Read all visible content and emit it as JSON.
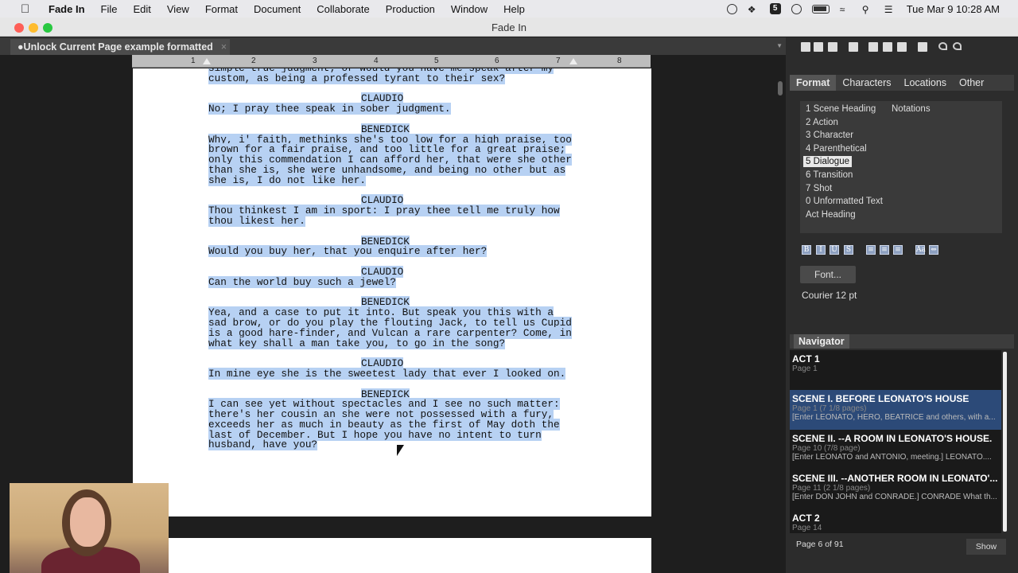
{
  "menubar": {
    "app_name": "Fade In",
    "items": [
      "File",
      "Edit",
      "View",
      "Format",
      "Document",
      "Collaborate",
      "Production",
      "Window",
      "Help"
    ],
    "clock": "Tue Mar 9  10:28 AM",
    "tray_icons": [
      "record-icon",
      "dropbox-icon",
      "five-icon",
      "play-icon",
      "battery-icon",
      "wifi-icon",
      "search-icon",
      "control-center-icon"
    ]
  },
  "window": {
    "title": "Fade In"
  },
  "document_tab": {
    "label": "●Unlock Current Page example formatted",
    "close": "×"
  },
  "ruler": {
    "numbers": [
      "1",
      "2",
      "3",
      "4",
      "5",
      "6",
      "7",
      "8"
    ]
  },
  "script": {
    "blocks": [
      {
        "type": "dialogue",
        "lines": [
          "simple true judgment; or would you have me speak after my",
          "custom, as being a professed tyrant to their sex?"
        ]
      },
      {
        "type": "character",
        "lines": [
          "CLAUDIO"
        ]
      },
      {
        "type": "dialogue",
        "lines": [
          "No; I pray thee speak in sober judgment."
        ]
      },
      {
        "type": "character",
        "lines": [
          "BENEDICK"
        ]
      },
      {
        "type": "dialogue",
        "lines": [
          "Why, i' faith, methinks she's too low for a high praise, too",
          "brown for a fair praise, and too little for a great praise;",
          "only this commendation I can afford her, that were she other",
          "than she is, she were unhandsome, and being no other but as",
          "she is, I do not like her."
        ]
      },
      {
        "type": "character",
        "lines": [
          "CLAUDIO"
        ]
      },
      {
        "type": "dialogue",
        "lines": [
          "Thou thinkest I am in sport: I pray thee tell me truly how",
          "thou likest her."
        ]
      },
      {
        "type": "character",
        "lines": [
          "BENEDICK"
        ]
      },
      {
        "type": "dialogue",
        "lines": [
          "Would you buy her, that you enquire after her?"
        ]
      },
      {
        "type": "character",
        "lines": [
          "CLAUDIO"
        ]
      },
      {
        "type": "dialogue",
        "lines": [
          "Can the world buy such a jewel?"
        ]
      },
      {
        "type": "character",
        "lines": [
          "BENEDICK"
        ]
      },
      {
        "type": "dialogue",
        "lines": [
          "Yea, and a case to put it into. But speak you this with a",
          "sad brow, or do you play the flouting Jack, to tell us Cupid",
          "is a good hare-finder, and Vulcan a rare carpenter? Come, in",
          "what key shall a man take you, to go in the song?"
        ]
      },
      {
        "type": "character",
        "lines": [
          "CLAUDIO"
        ]
      },
      {
        "type": "dialogue",
        "lines": [
          "In mine eye she is the sweetest lady that ever I looked on."
        ]
      },
      {
        "type": "character",
        "lines": [
          "BENEDICK"
        ]
      },
      {
        "type": "dialogue",
        "lines": [
          "I can see yet without spectacles and I see no such matter:",
          "there's her cousin an she were not possessed with a fury,",
          "exceeds her as much in beauty as the first of May doth the",
          "last of December. But I hope you have no intent to turn",
          "husband, have you?"
        ]
      }
    ]
  },
  "sidebar": {
    "tabs": [
      "Format",
      "Characters",
      "Locations",
      "Other"
    ],
    "active_tab": "Format",
    "format_items": [
      "1 Scene Heading",
      "2 Action",
      "3 Character",
      "4 Parenthetical",
      "5 Dialogue",
      "6 Transition",
      "7 Shot",
      "0 Unformatted Text",
      "Act Heading"
    ],
    "selected_format": "5 Dialogue",
    "notations": "Notations",
    "style_buttons": [
      "B",
      "I",
      "U",
      "S",
      "≡",
      "≡",
      "≡",
      "Aa",
      "⇔"
    ],
    "font_button": "Font...",
    "font_info": "Courier 12 pt",
    "navigator_label": "Navigator",
    "navigator_items": [
      {
        "title": "ACT 1",
        "page": "Page 1",
        "desc": ""
      },
      {
        "title": "SCENE I. BEFORE LEONATO'S HOUSE",
        "page": "Page 1 (7 1/8 pages)",
        "desc": "[Enter LEONATO, HERO, BEATRICE and others, with a...",
        "selected": true
      },
      {
        "title": "SCENE II. --A ROOM IN LEONATO'S HOUSE.",
        "page": "Page 10 (7/8 page)",
        "desc": "[Enter LEONATO and ANTONIO, meeting.]  LEONATO...."
      },
      {
        "title": "SCENE III. --ANOTHER ROOM IN LEONATO'...",
        "page": "Page 11 (2 1/8 pages)",
        "desc": "[Enter DON JOHN and CONRADE.]  CONRADE  What th..."
      },
      {
        "title": "ACT 2",
        "page": "Page 14",
        "desc": ""
      }
    ],
    "page_status": "Page 6 of 91",
    "show_button": "Show"
  },
  "colors": {
    "selection": "#b7d1f3",
    "nav_selected": "#2c4a78"
  }
}
